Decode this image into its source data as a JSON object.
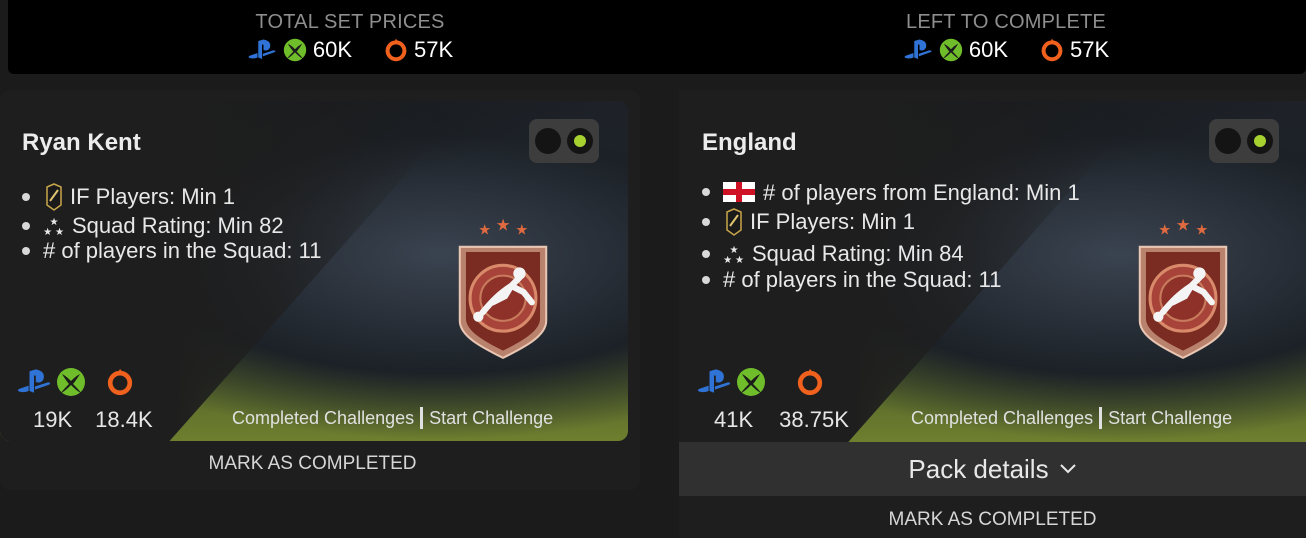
{
  "summary": {
    "total": {
      "title": "TOTAL SET PRICES",
      "console_price": "60K",
      "pc_price": "57K"
    },
    "left": {
      "title": "LEFT TO COMPLETE",
      "console_price": "60K",
      "pc_price": "57K"
    }
  },
  "colors": {
    "playstation": "#2f73d6",
    "xbox": "#6fbd2b",
    "origin": "#f0611e",
    "toggle_on": "#a6d12e"
  },
  "cards": [
    {
      "name": "Ryan Kent",
      "requirements": [
        {
          "icon": "if-card-icon",
          "text": "IF Players: Min 1"
        },
        {
          "icon": "rating-stars-icon",
          "text": "Squad Rating: Min 82"
        },
        {
          "icon": "",
          "text": "# of players in the Squad: 11"
        }
      ],
      "console_price": "19K",
      "pc_price": "18.4K",
      "completed_link": "Completed Challenges",
      "start_link": "Start Challenge",
      "mark_completed": "MARK AS COMPLETED"
    },
    {
      "name": "England",
      "requirements": [
        {
          "icon": "england-flag-icon",
          "text": "# of players from England: Min 1"
        },
        {
          "icon": "if-card-icon",
          "text": "IF Players: Min 1"
        },
        {
          "icon": "rating-stars-icon",
          "text": "Squad Rating: Min 84"
        },
        {
          "icon": "",
          "text": "# of players in the Squad: 11"
        }
      ],
      "console_price": "41K",
      "pc_price": "38.75K",
      "completed_link": "Completed Challenges",
      "start_link": "Start Challenge",
      "pack_details": "Pack details",
      "mark_completed": "MARK AS COMPLETED"
    }
  ]
}
